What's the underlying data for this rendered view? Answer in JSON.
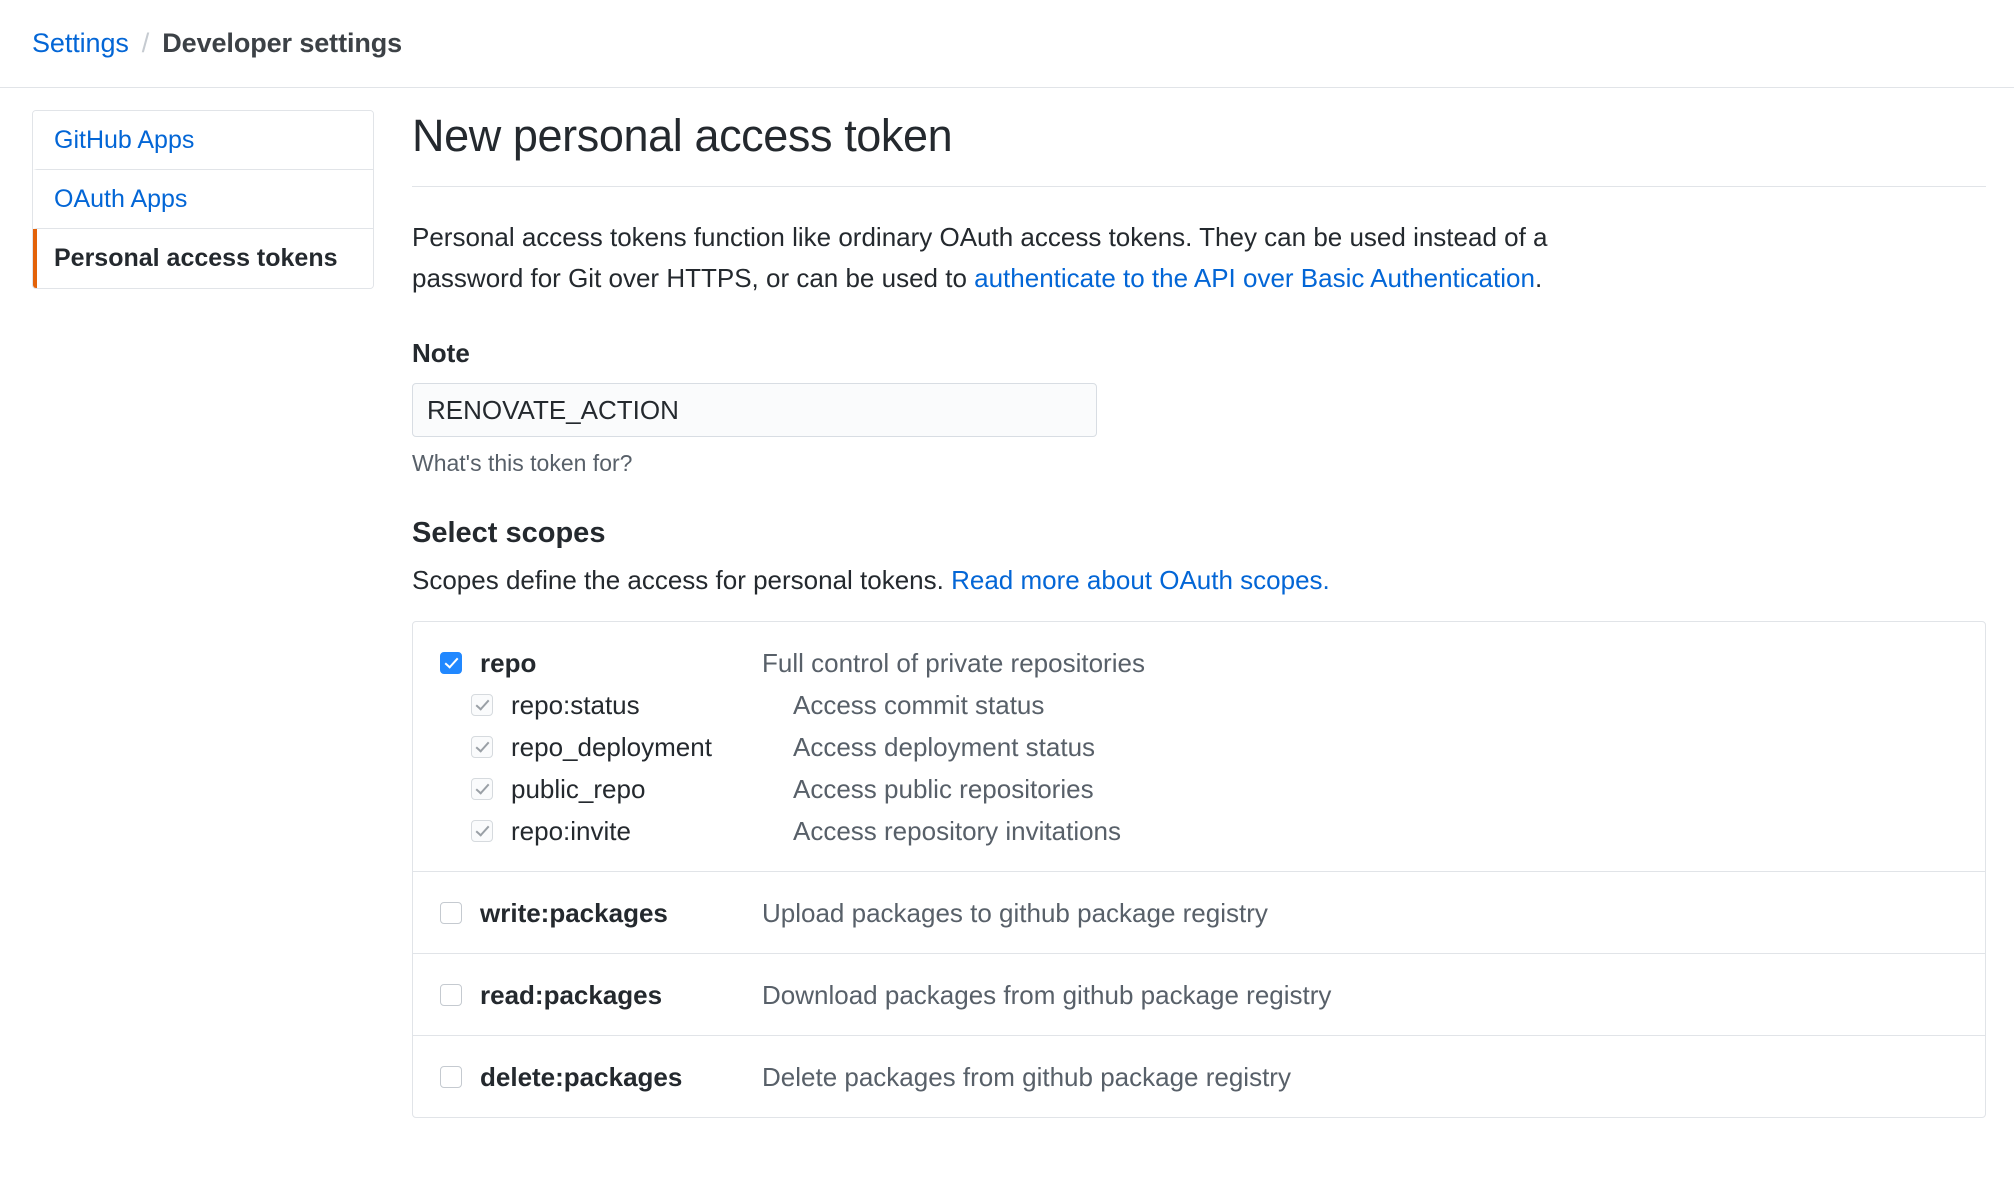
{
  "breadcrumb": {
    "root": "Settings",
    "separator": "/",
    "current": "Developer settings"
  },
  "sidebar": {
    "items": [
      {
        "label": "GitHub Apps",
        "selected": false
      },
      {
        "label": "OAuth Apps",
        "selected": false
      },
      {
        "label": "Personal access tokens",
        "selected": true
      }
    ]
  },
  "main": {
    "title": "New personal access token",
    "intro_before": "Personal access tokens function like ordinary OAuth access tokens. They can be used instead of a password for Git over HTTPS, or can be used to ",
    "intro_link": "authenticate to the API over Basic Authentication",
    "intro_after": ".",
    "note": {
      "label": "Note",
      "value": "RENOVATE_ACTION",
      "placeholder": "What's this token for?",
      "help": "What's this token for?"
    },
    "scopes": {
      "title": "Select scopes",
      "desc_before": "Scopes define the access for personal tokens. ",
      "desc_link": "Read more about OAuth scopes.",
      "groups": [
        {
          "parent": {
            "name": "repo",
            "description": "Full control of private repositories",
            "state": "checked"
          },
          "children": [
            {
              "name": "repo:status",
              "description": "Access commit status",
              "state": "disabled-checked"
            },
            {
              "name": "repo_deployment",
              "description": "Access deployment status",
              "state": "disabled-checked"
            },
            {
              "name": "public_repo",
              "description": "Access public repositories",
              "state": "disabled-checked"
            },
            {
              "name": "repo:invite",
              "description": "Access repository invitations",
              "state": "disabled-checked"
            }
          ]
        },
        {
          "parent": {
            "name": "write:packages",
            "description": "Upload packages to github package registry",
            "state": "unchecked"
          },
          "children": []
        },
        {
          "parent": {
            "name": "read:packages",
            "description": "Download packages from github package registry",
            "state": "unchecked"
          },
          "children": []
        },
        {
          "parent": {
            "name": "delete:packages",
            "description": "Delete packages from github package registry",
            "state": "unchecked"
          },
          "children": []
        }
      ]
    }
  },
  "colors": {
    "link": "#0366d6",
    "accent_selected": "#e36209",
    "checkbox_checked": "#2188ff",
    "border": "#e1e4e8"
  }
}
